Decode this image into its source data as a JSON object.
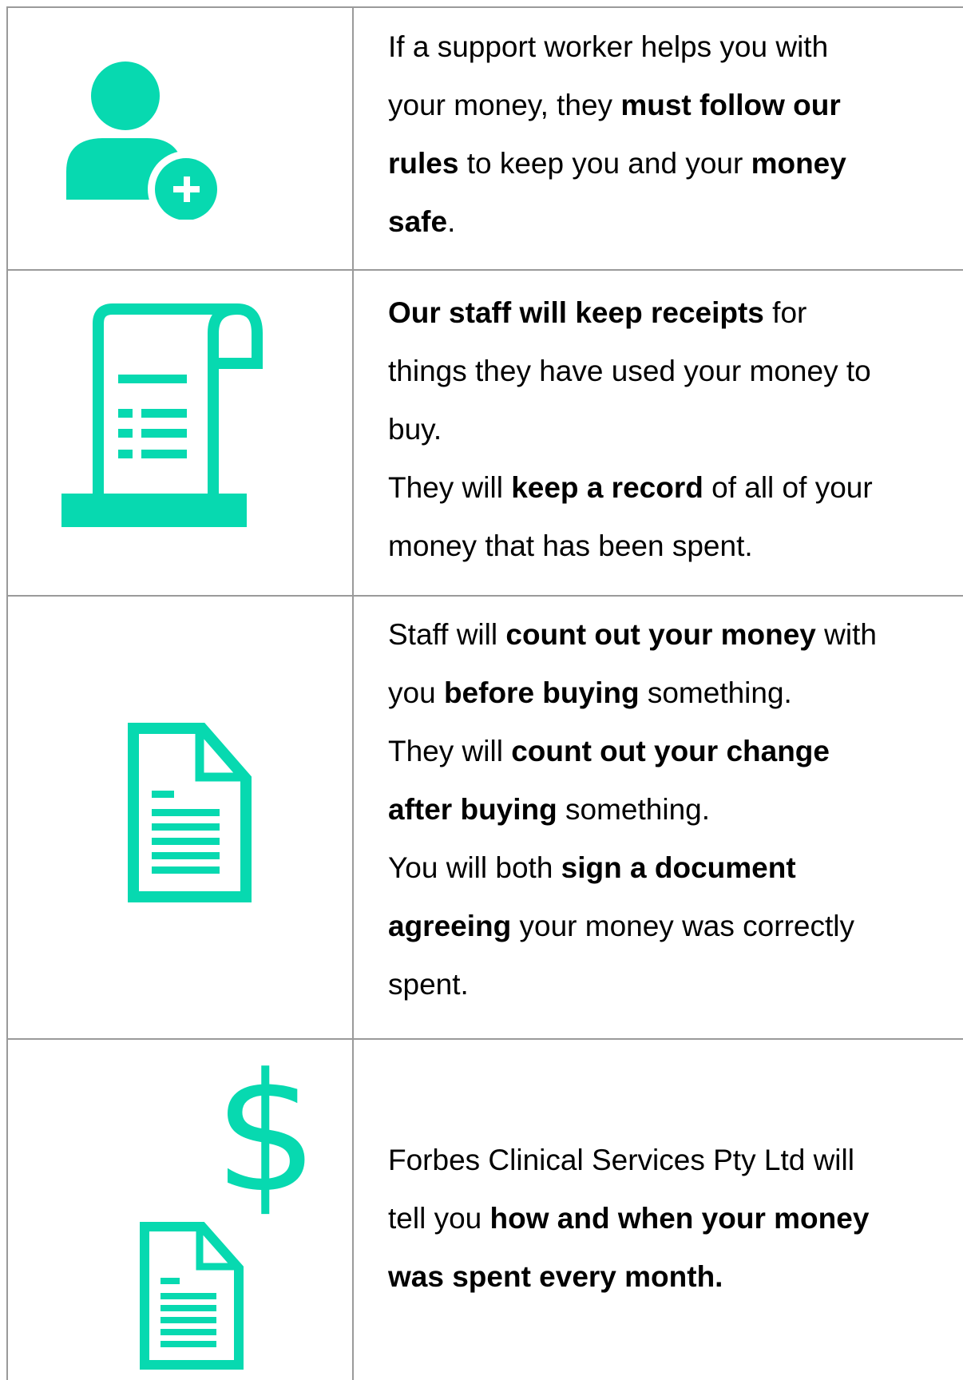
{
  "colors": {
    "accent": "#07d9b0",
    "border": "#9a9a9a"
  },
  "rows": [
    {
      "icon": "add-user-icon",
      "lines": [
        [
          {
            "t": "If a support worker helps you with",
            "b": false
          }
        ],
        [
          {
            "t": "your money, they ",
            "b": false
          },
          {
            "t": "must follow our",
            "b": true
          }
        ],
        [
          {
            "t": "rules",
            "b": true
          },
          {
            "t": " to keep you and your ",
            "b": false
          },
          {
            "t": "money",
            "b": true
          }
        ],
        [
          {
            "t": "safe",
            "b": true
          },
          {
            "t": ".",
            "b": false
          }
        ]
      ]
    },
    {
      "icon": "receipt-icon",
      "lines": [
        [
          {
            "t": "Our staff will keep receipts",
            "b": true
          },
          {
            "t": " for",
            "b": false
          }
        ],
        [
          {
            "t": "things they have used your money to",
            "b": false
          }
        ],
        [
          {
            "t": "buy.",
            "b": false
          }
        ],
        [
          {
            "t": "They will ",
            "b": false
          },
          {
            "t": "keep a record",
            "b": true
          },
          {
            "t": " of all of your",
            "b": false
          }
        ],
        [
          {
            "t": "money that has been spent.",
            "b": false
          }
        ]
      ]
    },
    {
      "icon": "document-icon",
      "lines": [
        [
          {
            "t": "Staff will ",
            "b": false
          },
          {
            "t": "count out your money",
            "b": true
          },
          {
            "t": " with",
            "b": false
          }
        ],
        [
          {
            "t": "you ",
            "b": false
          },
          {
            "t": "before buying",
            "b": true
          },
          {
            "t": " something.",
            "b": false
          }
        ],
        [
          {
            "t": "They will ",
            "b": false
          },
          {
            "t": "count out your change",
            "b": true
          }
        ],
        [
          {
            "t": "after buying",
            "b": true
          },
          {
            "t": " something.",
            "b": false
          }
        ],
        [
          {
            "t": "You will both ",
            "b": false
          },
          {
            "t": "sign a document",
            "b": true
          }
        ],
        [
          {
            "t": "agreeing",
            "b": true
          },
          {
            "t": " your money was correctly",
            "b": false
          }
        ],
        [
          {
            "t": "spent.",
            "b": false
          }
        ]
      ]
    },
    {
      "icon": "dollar-document-icon",
      "lines": [
        [
          {
            "t": "Forbes Clinical Services Pty Ltd will",
            "b": false
          }
        ],
        [
          {
            "t": "tell you ",
            "b": false
          },
          {
            "t": "how and when your money",
            "b": true
          }
        ],
        [
          {
            "t": "was spent every month.",
            "b": true
          }
        ]
      ]
    }
  ],
  "dollar_sign": "$"
}
